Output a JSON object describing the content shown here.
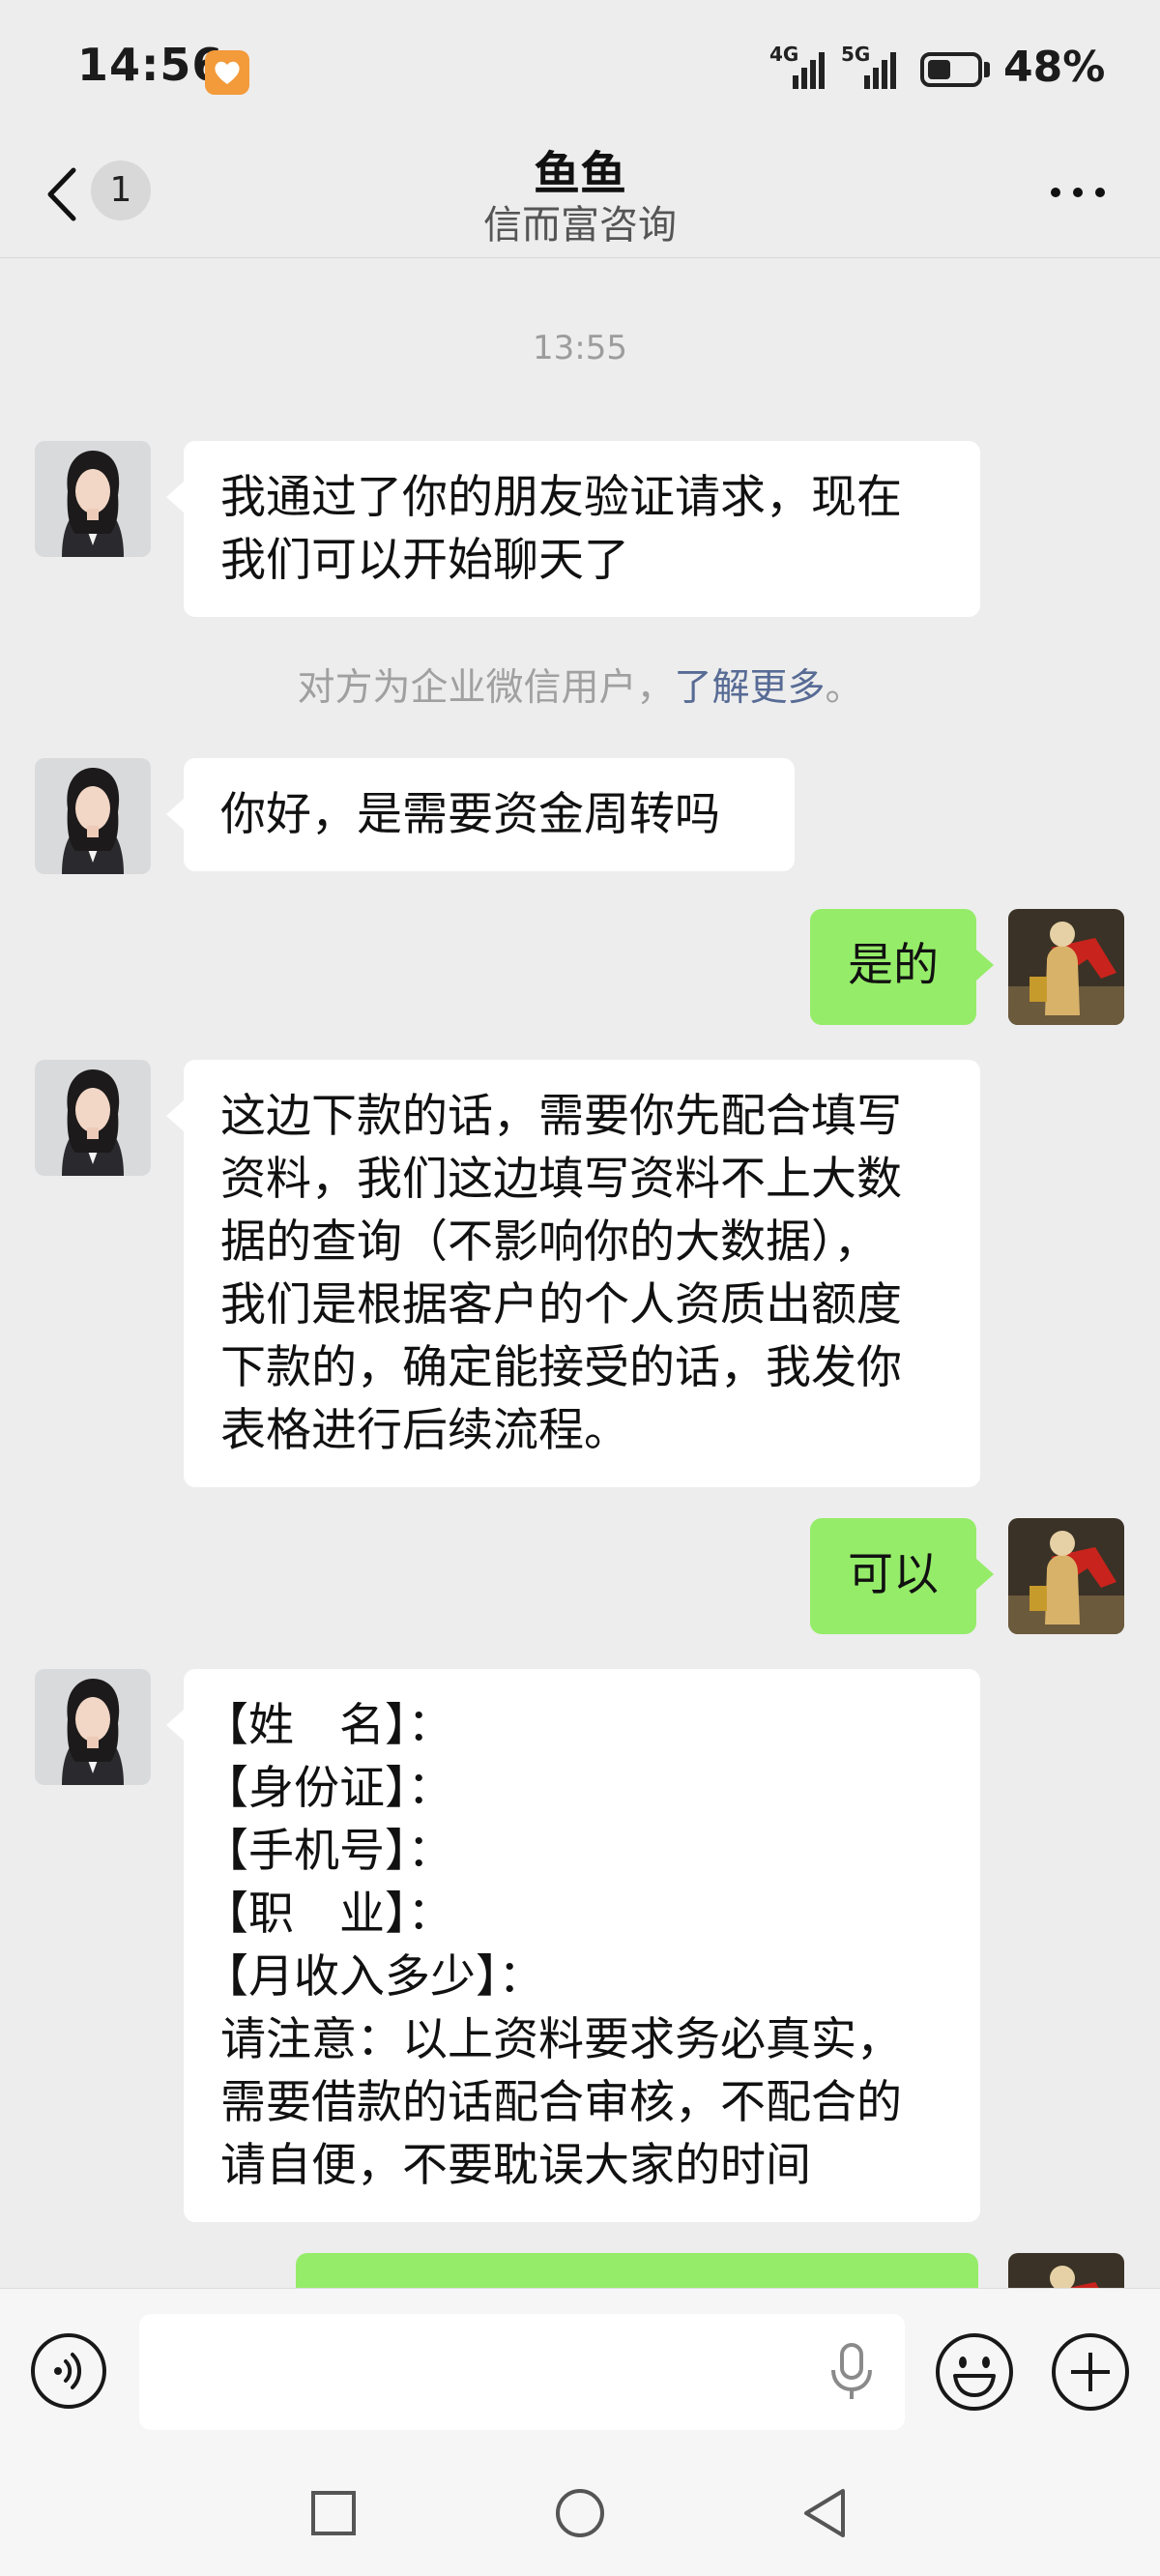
{
  "status_bar": {
    "time": "14:56",
    "signal_1_label": "4G",
    "signal_2_label": "5G",
    "battery_percent_text": "48%",
    "battery_level": 0.48
  },
  "nav": {
    "unread_count": "1",
    "title": "鱼鱼",
    "subtitle": "信而富咨询"
  },
  "chat": {
    "timestamp": "13:55",
    "system_notice": {
      "text": "对方为企业微信用户，",
      "link": "了解更多",
      "suffix": "。"
    },
    "messages": [
      {
        "from": "contact",
        "lines": [
          "我通过了你的朋友验证请求，现在",
          "我们可以开始聊天了"
        ]
      },
      {
        "from": "contact",
        "lines": [
          "你好，是需要资金周转吗"
        ]
      },
      {
        "from": "me",
        "lines": [
          "是的"
        ]
      },
      {
        "from": "contact",
        "lines": [
          "这边下款的话，需要你先配合填写",
          "资料，我们这边填写资料不上大数",
          "据的查询（不影响你的大数据），",
          "我们是根据客户的个人资质出额度",
          "下款的，确定能接受的话，我发你",
          "表格进行后续流程。"
        ]
      },
      {
        "from": "me",
        "lines": [
          "可以"
        ]
      },
      {
        "from": "contact",
        "lines": [
          "【姓　名】：",
          "【身份证】：",
          "【手机号】：",
          "【职　业】：",
          "【月收入多少】：",
          "请注意：以上资料要求务必真实，",
          "需要借款的话配合审核，不配合的",
          "请自便，不要耽误大家的时间"
        ]
      }
    ]
  },
  "input": {
    "value": "",
    "placeholder": ""
  },
  "colors": {
    "background": "#ededed",
    "outgoing_bubble": "#95ec69",
    "incoming_bubble": "#ffffff",
    "link": "#576b95"
  },
  "icons": {
    "status_badge": "heart-badge-icon",
    "back": "chevron-left-icon",
    "more": "more-dots-icon",
    "voice": "voice-icon",
    "mic": "microphone-icon",
    "emoji": "emoji-icon",
    "plus": "plus-icon",
    "home": "square-icon",
    "circle": "circle-icon",
    "back_nav": "triangle-back-icon"
  }
}
